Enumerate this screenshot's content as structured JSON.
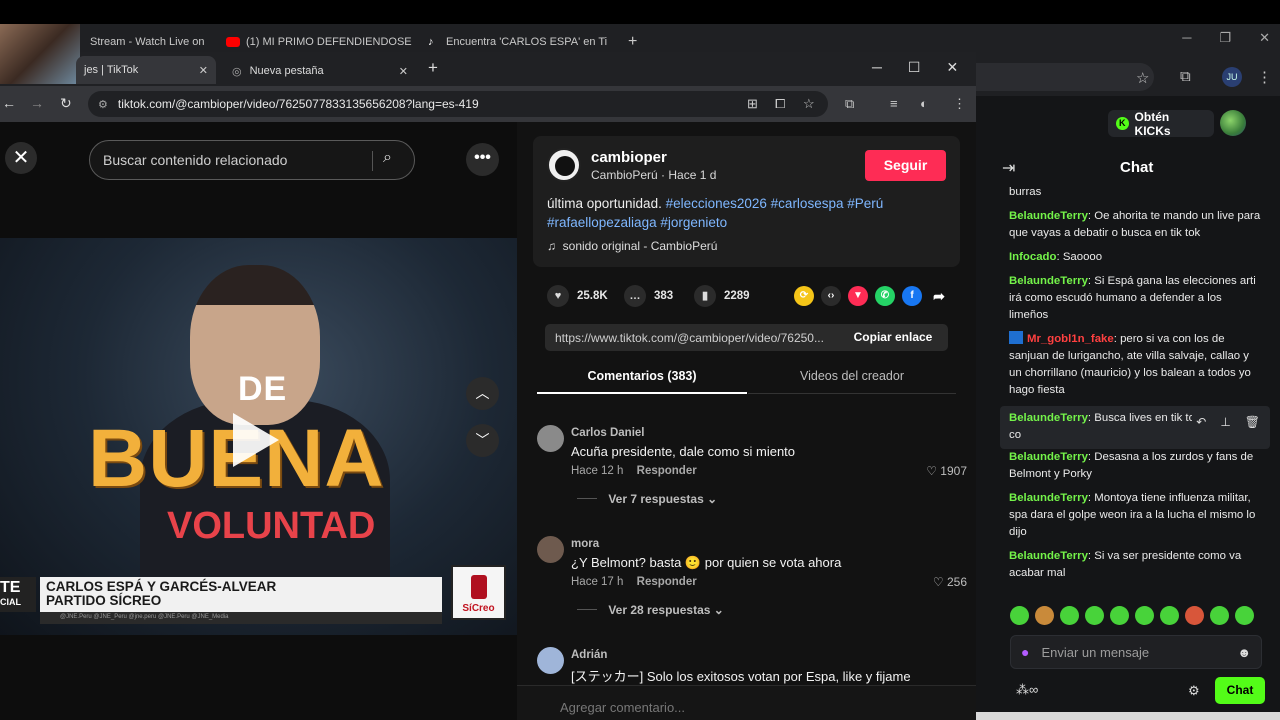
{
  "back_browser": {
    "tabs": [
      {
        "label": "Stream - Watch Live on"
      },
      {
        "label": "(1) MI PRIMO DEFENDIENDOSE"
      },
      {
        "label": "Encuentra 'CARLOS ESPA' en Ti"
      }
    ],
    "new_tab": "+",
    "profile": "JU"
  },
  "front_browser": {
    "tabs": [
      {
        "label": "jes | TikTok"
      },
      {
        "label": "Nueva pestaña"
      }
    ],
    "url": "tiktok.com/@cambioper/video/7625077833135656208?lang=es-419"
  },
  "tiktok": {
    "search_placeholder": "Buscar contenido relacionado",
    "video_overlay": {
      "line1": "DE",
      "line2": "BUENA",
      "line3": "VOLUNTAD",
      "lower_third_l1": "CARLOS ESPÁ Y GARCÉS-ALVEAR",
      "lower_third_l2": "PARTIDO SÍCREO",
      "lower_left_a": "TE",
      "lower_left_b": "CIAL",
      "lower_foot": "@JNE.Peru   @JNE_Peru   @jne.peru   @JNE.Peru   @JNE_Media",
      "logo_label": "SíCreo"
    },
    "creator": {
      "username": "cambioper",
      "subtitle": "CambioPerú · Hace 1 d",
      "follow_label": "Seguir"
    },
    "description": {
      "text": "última oportunidad.",
      "tags_line1": "#elecciones2026 #carlosespa #Perú",
      "tags_line2": "#rafaellopezaliaga #jorgenieto"
    },
    "sound": "sonido original - CambioPerú",
    "stats": {
      "likes": "25.8K",
      "comments": "383",
      "saves": "2289"
    },
    "link": {
      "url": "https://www.tiktok.com/@cambioper/video/76250...",
      "copy_label": "Copiar enlace"
    },
    "tabs": {
      "comments": "Comentarios (383)",
      "videos": "Videos del creador"
    },
    "comments": [
      {
        "name": "Carlos Daniel",
        "text": "Acuña presidente, dale como si miento",
        "time": "Hace 12 h",
        "reply": "Responder",
        "likes": "1907",
        "more": "Ver 7 respuestas"
      },
      {
        "name": "mora",
        "text": "¿Y Belmont? basta 🙂 por quien se vota ahora",
        "time": "Hace 17 h",
        "reply": "Responder",
        "likes": "256",
        "more": "Ver 28 respuestas"
      },
      {
        "name": "Adrián",
        "text": "[ステッカー] Solo los exitosos votan por Espa, like y fijame"
      }
    ],
    "comment_placeholder": "Agregar comentario..."
  },
  "kick": {
    "kicks_button": "Obtén KICKs",
    "chat_title": "Chat",
    "messages": [
      {
        "user": "",
        "text": "burras"
      },
      {
        "user": "BelaundeTerry",
        "text": "Oe ahorita te mando un live para que vayas a debatir o busca en tik tok"
      },
      {
        "user": "Infocado",
        "text": "Saoooo"
      },
      {
        "user": "BelaundeTerry",
        "text": "Si Espá gana las elecciones arti irá como escudó humano a defender a los limeños"
      },
      {
        "user": "Mr_gobl1n_fake",
        "text": "pero si va con los de sanjuan de lurigancho, ate villa salvaje, callao y un chorrillano (mauricio) y los balean a todos yo hago fiesta"
      },
      {
        "user": "BelaundeTerry",
        "text": "Busca lives en tik tok o debatir co"
      },
      {
        "user": "BelaundeTerry",
        "text": "Desasna a los zurdos y fans de Belmont y Porky"
      },
      {
        "user": "BelaundeTerry",
        "text": "Montoya tiene influenza militar, spa dara el golpe weon ira a la lucha el mismo lo dijo"
      },
      {
        "user": "BelaundeTerry",
        "text": "Si va ser presidente como va acabar mal"
      }
    ],
    "input_placeholder": "Enviar un mensaje",
    "send_label": "Chat"
  }
}
